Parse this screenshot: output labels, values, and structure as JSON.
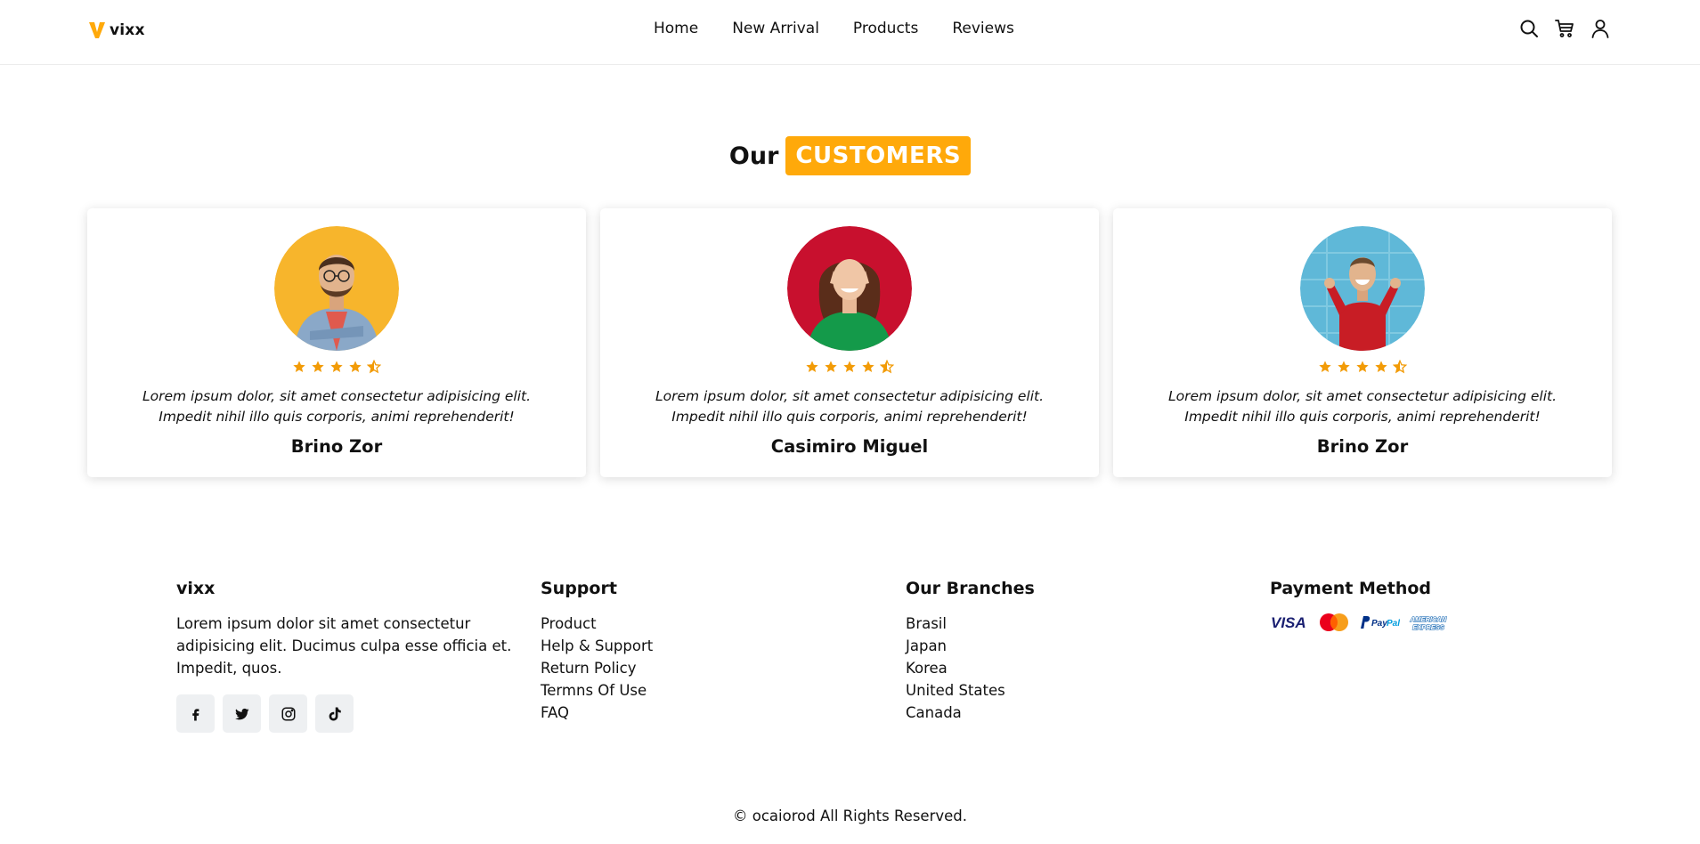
{
  "header": {
    "brand": "vixx",
    "nav": [
      "Home",
      "New Arrival",
      "Products",
      "Reviews"
    ],
    "icons": [
      "search-icon",
      "cart-icon",
      "user-icon"
    ]
  },
  "section": {
    "title_prefix": "Our",
    "title_highlight": "CUSTOMERS"
  },
  "testimonials": [
    {
      "name": "Brino Zor",
      "quote": "Lorem ipsum dolor, sit amet consectetur adipisicing elit. Impedit nihil illo quis corporis, animi reprehenderit!",
      "rating": 4.5,
      "avatar_bg": "#f7b52c"
    },
    {
      "name": "Casimiro Miguel",
      "quote": "Lorem ipsum dolor, sit amet consectetur adipisicing elit. Impedit nihil illo quis corporis, animi reprehenderit!",
      "rating": 4.5,
      "avatar_bg": "#c8102e"
    },
    {
      "name": "Brino Zor",
      "quote": "Lorem ipsum dolor, sit amet consectetur adipisicing elit. Impedit nihil illo quis corporis, animi reprehenderit!",
      "rating": 4.5,
      "avatar_bg": "#5fb8d8"
    }
  ],
  "footer": {
    "about": {
      "title": "vixx",
      "text": "Lorem ipsum dolor sit amet consectetur adipisicing elit. Ducimus culpa esse officia et. Impedit, quos.",
      "socials": [
        "facebook-icon",
        "twitter-icon",
        "instagram-icon",
        "tiktok-icon"
      ]
    },
    "support": {
      "title": "Support",
      "links": [
        "Product",
        "Help & Support",
        "Return Policy",
        "Termns Of Use",
        "FAQ"
      ]
    },
    "branches": {
      "title": "Our Branches",
      "links": [
        "Brasil",
        "Japan",
        "Korea",
        "United States",
        "Canada"
      ]
    },
    "payment": {
      "title": "Payment Method",
      "methods": [
        "visa-icon",
        "mastercard-icon",
        "paypal-icon",
        "amex-icon"
      ]
    },
    "copyright": "© ocaiorod All Rights Reserved."
  },
  "colors": {
    "accent": "#ffa90a",
    "star": "#f29b07"
  }
}
